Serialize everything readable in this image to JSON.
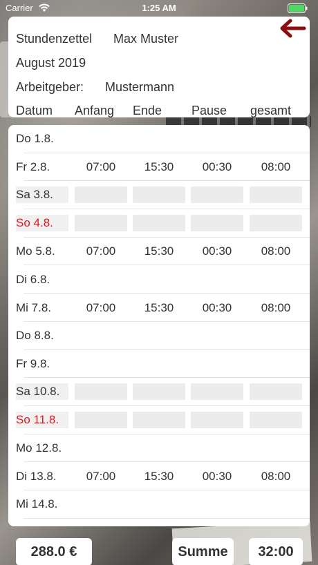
{
  "status_bar": {
    "carrier": "Carrier",
    "time": "1:25 AM"
  },
  "header": {
    "title": "Stundenzettel",
    "name": "Max Muster",
    "month": "August 2019",
    "employer_label": "Arbeitgeber:",
    "employer": "Mustermann"
  },
  "columns": [
    "Datum",
    "Anfang",
    "Ende",
    "Pause",
    "gesamt"
  ],
  "rows": [
    {
      "date": "Do 1.8.",
      "start": "",
      "end": "",
      "pause": "",
      "total": "",
      "kind": "normal"
    },
    {
      "date": "Fr 2.8.",
      "start": "07:00",
      "end": "15:30",
      "pause": "00:30",
      "total": "08:00",
      "kind": "normal"
    },
    {
      "date": "Sa 3.8.",
      "start": "",
      "end": "",
      "pause": "",
      "total": "",
      "kind": "saturday"
    },
    {
      "date": "So 4.8.",
      "start": "",
      "end": "",
      "pause": "",
      "total": "",
      "kind": "sunday"
    },
    {
      "date": "Mo 5.8.",
      "start": "07:00",
      "end": "15:30",
      "pause": "00:30",
      "total": "08:00",
      "kind": "normal"
    },
    {
      "date": "Di 6.8.",
      "start": "",
      "end": "",
      "pause": "",
      "total": "",
      "kind": "normal"
    },
    {
      "date": "Mi 7.8.",
      "start": "07:00",
      "end": "15:30",
      "pause": "00:30",
      "total": "08:00",
      "kind": "normal"
    },
    {
      "date": "Do 8.8.",
      "start": "",
      "end": "",
      "pause": "",
      "total": "",
      "kind": "normal"
    },
    {
      "date": "Fr 9.8.",
      "start": "",
      "end": "",
      "pause": "",
      "total": "",
      "kind": "normal"
    },
    {
      "date": "Sa 10.8.",
      "start": "",
      "end": "",
      "pause": "",
      "total": "",
      "kind": "saturday"
    },
    {
      "date": "So 11.8.",
      "start": "",
      "end": "",
      "pause": "",
      "total": "",
      "kind": "sunday"
    },
    {
      "date": "Mo 12.8.",
      "start": "",
      "end": "",
      "pause": "",
      "total": "",
      "kind": "normal"
    },
    {
      "date": "Di 13.8.",
      "start": "07:00",
      "end": "15:30",
      "pause": "00:30",
      "total": "08:00",
      "kind": "normal"
    },
    {
      "date": "Mi 14.8.",
      "start": "",
      "end": "",
      "pause": "",
      "total": "",
      "kind": "normal"
    }
  ],
  "footer": {
    "amount": "288.0 €",
    "sum_label": "Summe",
    "sum_total": "32:00"
  },
  "colors": {
    "accent": "#8b0d0d",
    "sunday": "#e2161f"
  }
}
